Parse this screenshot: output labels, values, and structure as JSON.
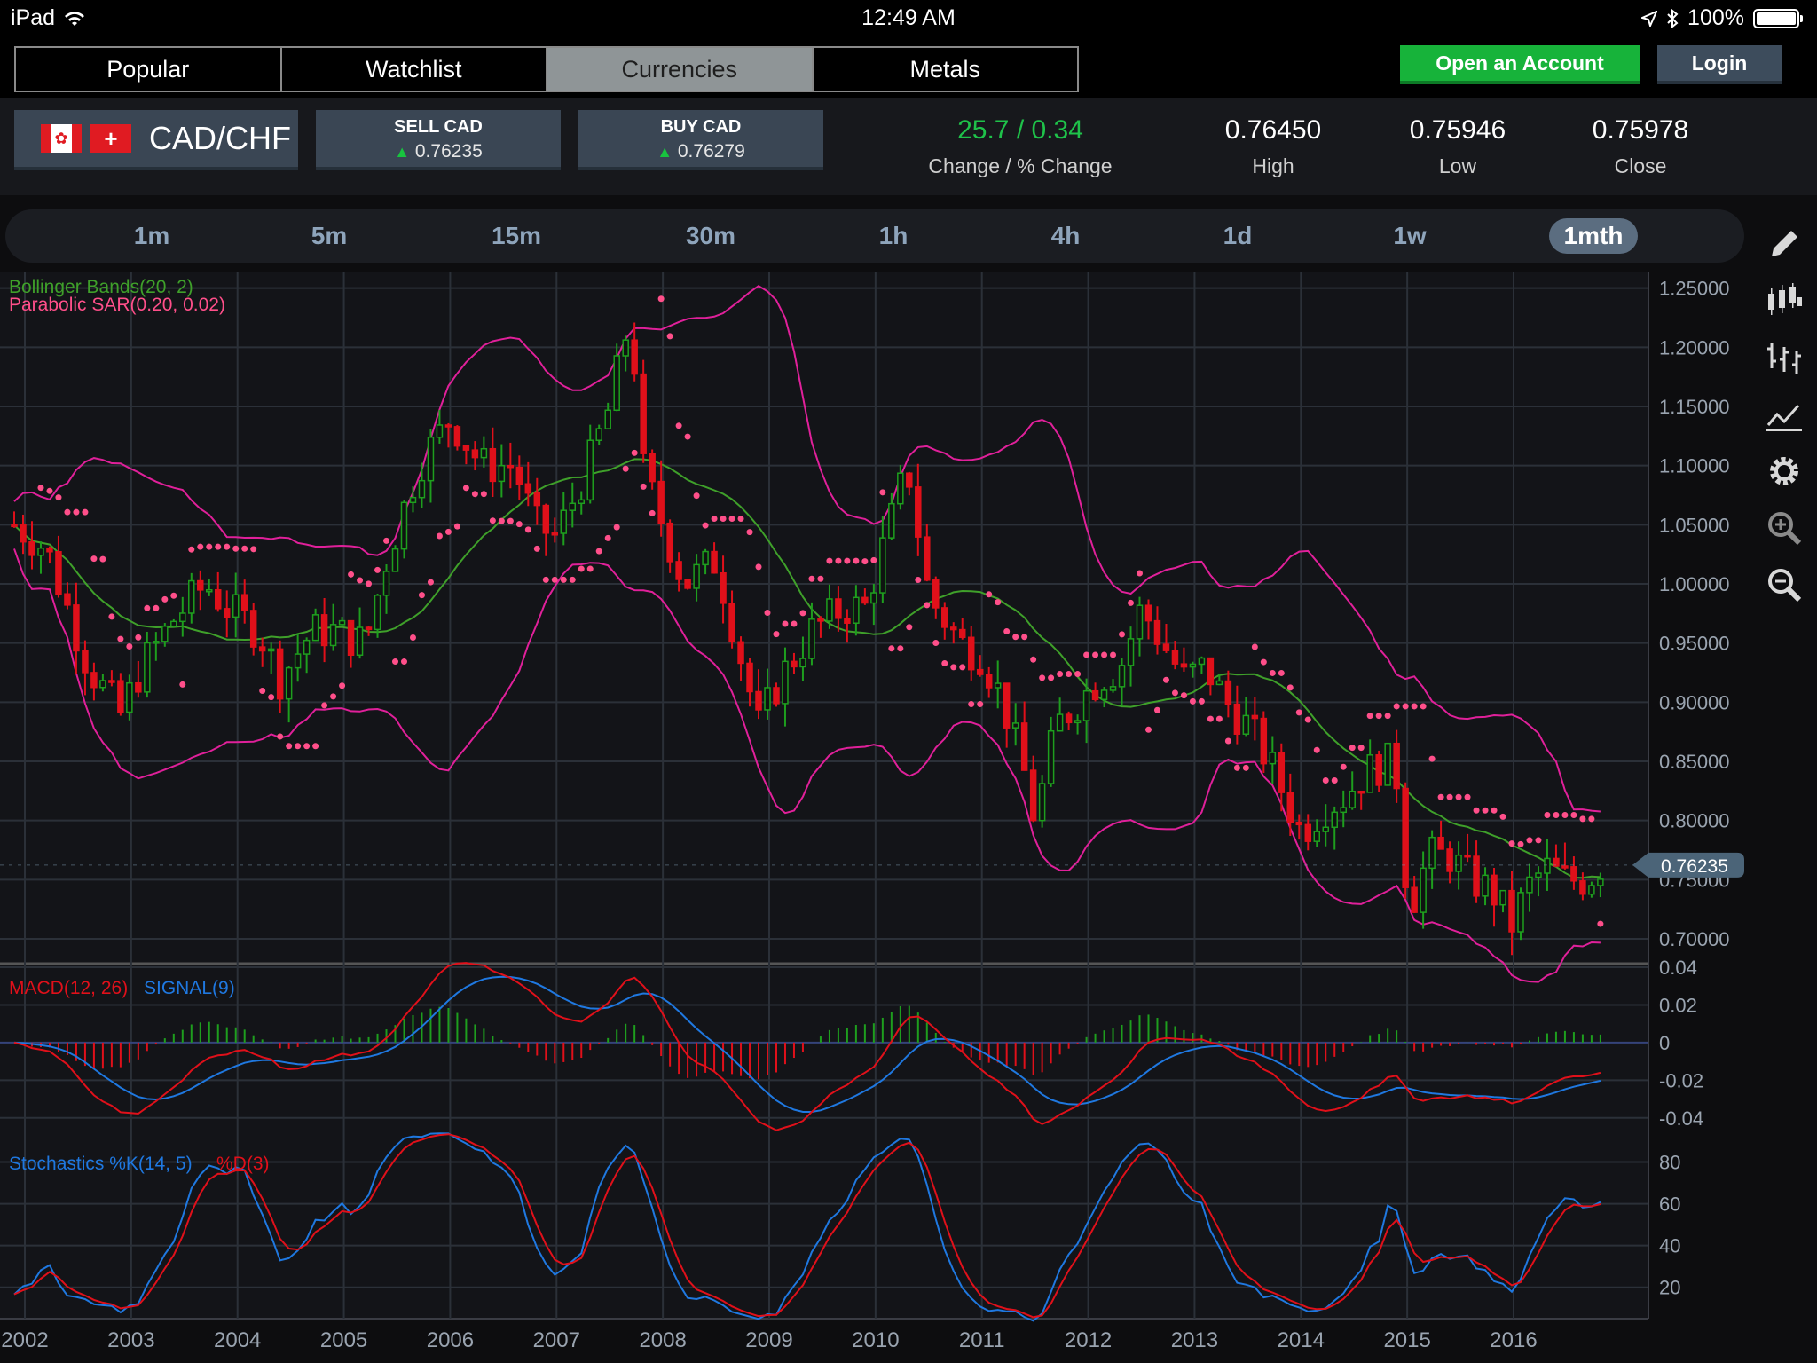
{
  "status": {
    "device": "iPad",
    "time": "12:49 AM",
    "battery": "100%"
  },
  "nav": {
    "tabs": [
      {
        "label": "Popular",
        "active": false
      },
      {
        "label": "Watchlist",
        "active": false
      },
      {
        "label": "Currencies",
        "active": true
      },
      {
        "label": "Metals",
        "active": false
      }
    ],
    "open_account": "Open an Account",
    "login": "Login"
  },
  "quote": {
    "pair": "CAD/CHF",
    "sell_label": "SELL CAD",
    "sell_price": "0.76235",
    "buy_label": "BUY CAD",
    "buy_price": "0.76279",
    "change_value": "25.7 / 0.34",
    "change_label": "Change / % Change",
    "change_color": "#1fc24a",
    "high_value": "0.76450",
    "high_label": "High",
    "low_value": "0.75946",
    "low_label": "Low",
    "close_value": "0.75978",
    "close_label": "Close"
  },
  "timeframes": [
    {
      "label": "1m",
      "active": false
    },
    {
      "label": "5m",
      "active": false
    },
    {
      "label": "15m",
      "active": false
    },
    {
      "label": "30m",
      "active": false
    },
    {
      "label": "1h",
      "active": false
    },
    {
      "label": "4h",
      "active": false
    },
    {
      "label": "1d",
      "active": false
    },
    {
      "label": "1w",
      "active": false
    },
    {
      "label": "1mth",
      "active": true
    }
  ],
  "toolbar": [
    "pencil-icon",
    "candlestick-icon",
    "ohlc-bars-icon",
    "line-chart-icon",
    "gear-icon",
    "zoom-in-icon",
    "zoom-out-icon"
  ],
  "chart_data": {
    "type": "candlestick",
    "x_labels": [
      "2002",
      "2003",
      "2004",
      "2005",
      "2006",
      "2007",
      "2008",
      "2009",
      "2010",
      "2011",
      "2012",
      "2013",
      "2014",
      "2015",
      "2016"
    ],
    "current_price": "0.76235",
    "colors": {
      "up": "#1e9e1e",
      "down": "#e0101a",
      "bollinger_mid": "#3fa02a",
      "bollinger_band": "#e0209a",
      "sar": "#ff4f8a",
      "macd": "#e0101a",
      "signal": "#1f78e0",
      "stoch_k": "#1f78e0",
      "stoch_d": "#e0101a"
    },
    "price_panel": {
      "indicators": [
        "Bollinger Bands(20, 2)",
        "Parabolic SAR(0.20, 0.02)"
      ],
      "y_ticks": [
        "1.25000",
        "1.20000",
        "1.15000",
        "1.10000",
        "1.05000",
        "1.00000",
        "0.95000",
        "0.90000",
        "0.85000",
        "0.80000",
        "0.75000",
        "0.70000"
      ],
      "ylim": [
        0.685,
        1.255
      ],
      "close_path": [
        {
          "t": 2001.9,
          "v": 1.05
        },
        {
          "t": 2002.2,
          "v": 1.03
        },
        {
          "t": 2002.4,
          "v": 0.98
        },
        {
          "t": 2002.6,
          "v": 0.93
        },
        {
          "t": 2002.9,
          "v": 0.89
        },
        {
          "t": 2003.1,
          "v": 0.93
        },
        {
          "t": 2003.4,
          "v": 0.97
        },
        {
          "t": 2003.7,
          "v": 1.0
        },
        {
          "t": 2003.9,
          "v": 0.98
        },
        {
          "t": 2004.2,
          "v": 0.96
        },
        {
          "t": 2004.4,
          "v": 0.92
        },
        {
          "t": 2004.7,
          "v": 0.96
        },
        {
          "t": 2004.9,
          "v": 0.96
        },
        {
          "t": 2005.2,
          "v": 0.95
        },
        {
          "t": 2005.4,
          "v": 1.02
        },
        {
          "t": 2005.7,
          "v": 1.1
        },
        {
          "t": 2006.0,
          "v": 1.14
        },
        {
          "t": 2006.3,
          "v": 1.1
        },
        {
          "t": 2006.6,
          "v": 1.1
        },
        {
          "t": 2006.8,
          "v": 1.05
        },
        {
          "t": 2007.0,
          "v": 1.04
        },
        {
          "t": 2007.3,
          "v": 1.1
        },
        {
          "t": 2007.5,
          "v": 1.15
        },
        {
          "t": 2007.7,
          "v": 1.23
        },
        {
          "t": 2007.8,
          "v": 1.1
        },
        {
          "t": 2008.0,
          "v": 1.05
        },
        {
          "t": 2008.2,
          "v": 1.0
        },
        {
          "t": 2008.5,
          "v": 1.02
        },
        {
          "t": 2008.7,
          "v": 0.95
        },
        {
          "t": 2008.9,
          "v": 0.88
        },
        {
          "t": 2009.1,
          "v": 0.92
        },
        {
          "t": 2009.4,
          "v": 0.96
        },
        {
          "t": 2009.7,
          "v": 0.98
        },
        {
          "t": 2009.9,
          "v": 0.98
        },
        {
          "t": 2010.1,
          "v": 1.04
        },
        {
          "t": 2010.3,
          "v": 1.1
        },
        {
          "t": 2010.5,
          "v": 0.99
        },
        {
          "t": 2010.8,
          "v": 0.95
        },
        {
          "t": 2011.0,
          "v": 0.94
        },
        {
          "t": 2011.2,
          "v": 0.9
        },
        {
          "t": 2011.4,
          "v": 0.84
        },
        {
          "t": 2011.5,
          "v": 0.8
        },
        {
          "t": 2011.7,
          "v": 0.88
        },
        {
          "t": 2011.9,
          "v": 0.9
        },
        {
          "t": 2012.1,
          "v": 0.92
        },
        {
          "t": 2012.3,
          "v": 0.93
        },
        {
          "t": 2012.5,
          "v": 0.98
        },
        {
          "t": 2012.7,
          "v": 0.95
        },
        {
          "t": 2012.9,
          "v": 0.92
        },
        {
          "t": 2013.1,
          "v": 0.93
        },
        {
          "t": 2013.3,
          "v": 0.9
        },
        {
          "t": 2013.5,
          "v": 0.88
        },
        {
          "t": 2013.7,
          "v": 0.85
        },
        {
          "t": 2014.0,
          "v": 0.79
        },
        {
          "t": 2014.2,
          "v": 0.81
        },
        {
          "t": 2014.4,
          "v": 0.82
        },
        {
          "t": 2014.6,
          "v": 0.84
        },
        {
          "t": 2014.8,
          "v": 0.85
        },
        {
          "t": 2014.95,
          "v": 0.83
        },
        {
          "t": 2015.0,
          "v": 0.72
        },
        {
          "t": 2015.2,
          "v": 0.77
        },
        {
          "t": 2015.4,
          "v": 0.77
        },
        {
          "t": 2015.6,
          "v": 0.75
        },
        {
          "t": 2015.8,
          "v": 0.74
        },
        {
          "t": 2016.0,
          "v": 0.71
        },
        {
          "t": 2016.1,
          "v": 0.74
        },
        {
          "t": 2016.3,
          "v": 0.76
        },
        {
          "t": 2016.5,
          "v": 0.75
        },
        {
          "t": 2016.7,
          "v": 0.75
        },
        {
          "t": 2016.8,
          "v": 0.762
        }
      ]
    },
    "macd_panel": {
      "label_macd": "MACD(12, 26)",
      "label_signal": "SIGNAL(9)",
      "y_ticks": [
        "0.04",
        "0.02",
        "0",
        "-0.02",
        "-0.04"
      ],
      "ylim": [
        -0.05,
        0.04
      ]
    },
    "stoch_panel": {
      "label_k": "Stochastics %K(14, 5)",
      "label_d": "%D(3)",
      "y_ticks": [
        "80",
        "60",
        "40",
        "20"
      ],
      "ylim": [
        5,
        90
      ]
    }
  }
}
